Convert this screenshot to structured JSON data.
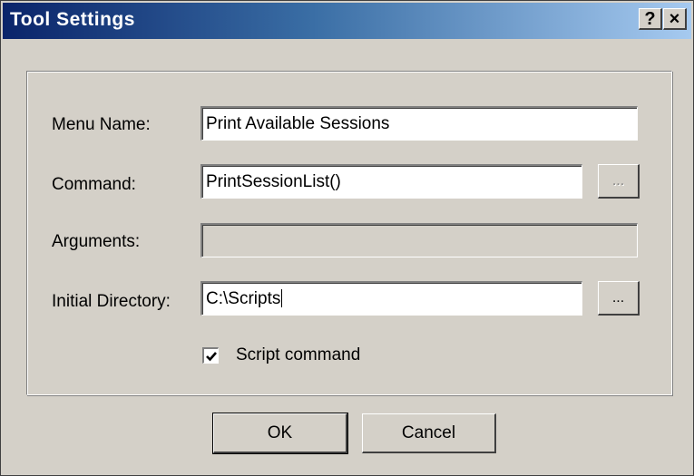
{
  "window": {
    "title": "Tool Settings",
    "help_label": "?",
    "close_label": "×"
  },
  "form": {
    "menu_name": {
      "label": "Menu Name:",
      "value": "Print Available Sessions"
    },
    "command": {
      "label": "Command:",
      "value": "PrintSessionList()",
      "browse_label": "..."
    },
    "arguments": {
      "label": "Arguments:",
      "value": ""
    },
    "initial_directory": {
      "label": "Initial Directory:",
      "value": "C:\\Scripts",
      "browse_label": "..."
    },
    "script_command": {
      "label": "Script command",
      "checked": true
    }
  },
  "buttons": {
    "ok": "OK",
    "cancel": "Cancel"
  }
}
